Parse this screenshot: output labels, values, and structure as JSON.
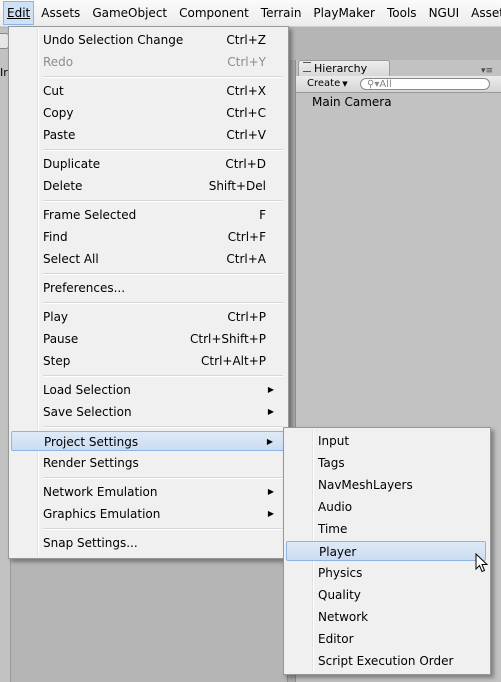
{
  "menubar": {
    "items": [
      "Edit",
      "Assets",
      "GameObject",
      "Component",
      "Terrain",
      "PlayMaker",
      "Tools",
      "NGUI",
      "Asset St"
    ]
  },
  "background": {
    "left_label": "Ir",
    "hierarchy_tab": "Hierarchy",
    "create_label": "Create",
    "search_placeholder": "All",
    "hierarchy_items": [
      "Main Camera"
    ]
  },
  "edit_menu": {
    "items": [
      {
        "label": "Undo Selection Change",
        "shortcut": "Ctrl+Z"
      },
      {
        "label": "Redo",
        "shortcut": "Ctrl+Y",
        "disabled": true
      },
      {
        "label": "Cut",
        "shortcut": "Ctrl+X"
      },
      {
        "label": "Copy",
        "shortcut": "Ctrl+C"
      },
      {
        "label": "Paste",
        "shortcut": "Ctrl+V"
      },
      {
        "label": "Duplicate",
        "shortcut": "Ctrl+D"
      },
      {
        "label": "Delete",
        "shortcut": "Shift+Del"
      },
      {
        "label": "Frame Selected",
        "shortcut": "F"
      },
      {
        "label": "Find",
        "shortcut": "Ctrl+F"
      },
      {
        "label": "Select All",
        "shortcut": "Ctrl+A"
      },
      {
        "label": "Preferences..."
      },
      {
        "label": "Play",
        "shortcut": "Ctrl+P"
      },
      {
        "label": "Pause",
        "shortcut": "Ctrl+Shift+P"
      },
      {
        "label": "Step",
        "shortcut": "Ctrl+Alt+P"
      },
      {
        "label": "Load Selection",
        "submenu": true
      },
      {
        "label": "Save Selection",
        "submenu": true
      },
      {
        "label": "Project Settings",
        "submenu": true,
        "highlighted": true
      },
      {
        "label": "Render Settings"
      },
      {
        "label": "Network Emulation",
        "submenu": true
      },
      {
        "label": "Graphics Emulation",
        "submenu": true
      },
      {
        "label": "Snap Settings..."
      }
    ]
  },
  "project_settings_menu": {
    "items": [
      {
        "label": "Input"
      },
      {
        "label": "Tags"
      },
      {
        "label": "NavMeshLayers"
      },
      {
        "label": "Audio"
      },
      {
        "label": "Time"
      },
      {
        "label": "Player",
        "highlighted": true
      },
      {
        "label": "Physics"
      },
      {
        "label": "Quality"
      },
      {
        "label": "Network"
      },
      {
        "label": "Editor"
      },
      {
        "label": "Script Execution Order"
      }
    ]
  }
}
